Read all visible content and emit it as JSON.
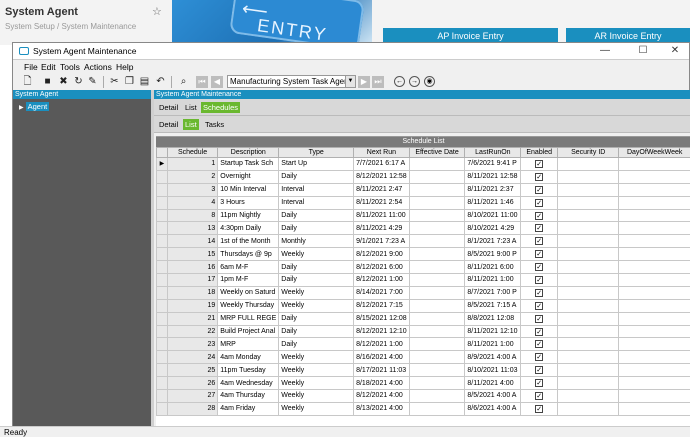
{
  "app": {
    "title": "System Agent",
    "breadcrumb": "System Setup / System Maintenance",
    "banner_text": "ENTRY",
    "tiles": [
      "AP Invoice Entry",
      "AR Invoice Entry"
    ]
  },
  "window": {
    "title": "System Agent Maintenance",
    "controls": {
      "minimize": "—",
      "maximize": "☐",
      "close": "✕"
    }
  },
  "menu": [
    "File",
    "Edit",
    "Tools",
    "Actions",
    "Help"
  ],
  "toolbar": {
    "combo_value": "Manufacturing System Task Agen"
  },
  "left_panel": {
    "header": "System Agent",
    "item": "Agent"
  },
  "right_panel": {
    "header": "System Agent Maintenance",
    "tabs_top": [
      "Detail",
      "List",
      "Schedules"
    ],
    "tabs_sub": [
      "Detail",
      "List",
      "Tasks"
    ]
  },
  "grid": {
    "title": "Schedule List",
    "columns": [
      "Schedule",
      "Description",
      "Type",
      "Next Run",
      "Effective Date",
      "LastRunOn",
      "Enabled",
      "Security ID",
      "DayOfWeekWeek"
    ],
    "rows": [
      {
        "schedule": "1",
        "description": "Startup Task Sch",
        "type": "Start Up",
        "next_run": "7/7/2021 6:17 A",
        "effective": "",
        "last_run": "7/6/2021 9:41 P",
        "enabled": true
      },
      {
        "schedule": "2",
        "description": "Overnight",
        "type": "Daily",
        "next_run": "8/12/2021 12:58",
        "effective": "",
        "last_run": "8/11/2021 12:58",
        "enabled": true
      },
      {
        "schedule": "3",
        "description": "10 Min Interval",
        "type": "Interval",
        "next_run": "8/11/2021 2:47",
        "effective": "",
        "last_run": "8/11/2021 2:37",
        "enabled": true
      },
      {
        "schedule": "4",
        "description": "3 Hours",
        "type": "Interval",
        "next_run": "8/11/2021 2:54",
        "effective": "",
        "last_run": "8/11/2021 1:46",
        "enabled": true
      },
      {
        "schedule": "8",
        "description": "11pm Nightly",
        "type": "Daily",
        "next_run": "8/11/2021 11:00",
        "effective": "",
        "last_run": "8/10/2021 11:00",
        "enabled": true
      },
      {
        "schedule": "13",
        "description": "4:30pm Daily",
        "type": "Daily",
        "next_run": "8/11/2021 4:29",
        "effective": "",
        "last_run": "8/10/2021 4:29",
        "enabled": true
      },
      {
        "schedule": "14",
        "description": "1st of the Month",
        "type": "Monthly",
        "next_run": "9/1/2021 7:23 A",
        "effective": "",
        "last_run": "8/1/2021 7:23 A",
        "enabled": true
      },
      {
        "schedule": "15",
        "description": "Thursdays @ 9p",
        "type": "Weekly",
        "next_run": "8/12/2021 9:00",
        "effective": "",
        "last_run": "8/5/2021 9:00 P",
        "enabled": true
      },
      {
        "schedule": "16",
        "description": "6am M-F",
        "type": "Daily",
        "next_run": "8/12/2021 6:00",
        "effective": "",
        "last_run": "8/11/2021 6:00",
        "enabled": true
      },
      {
        "schedule": "17",
        "description": "1pm M-F",
        "type": "Daily",
        "next_run": "8/12/2021 1:00",
        "effective": "",
        "last_run": "8/11/2021 1:00",
        "enabled": true
      },
      {
        "schedule": "18",
        "description": "Weekly on Saturd",
        "type": "Weekly",
        "next_run": "8/14/2021 7:00",
        "effective": "",
        "last_run": "8/7/2021 7:00 P",
        "enabled": true
      },
      {
        "schedule": "19",
        "description": "Weekly Thursday",
        "type": "Weekly",
        "next_run": "8/12/2021 7:15",
        "effective": "",
        "last_run": "8/5/2021 7:15 A",
        "enabled": true
      },
      {
        "schedule": "21",
        "description": "MRP FULL REGE",
        "type": "Daily",
        "next_run": "8/15/2021 12:08",
        "effective": "",
        "last_run": "8/8/2021 12:08",
        "enabled": true
      },
      {
        "schedule": "22",
        "description": "Build Project Anal",
        "type": "Daily",
        "next_run": "8/12/2021 12:10",
        "effective": "",
        "last_run": "8/11/2021 12:10",
        "enabled": true
      },
      {
        "schedule": "23",
        "description": "MRP",
        "type": "Daily",
        "next_run": "8/12/2021 1:00",
        "effective": "",
        "last_run": "8/11/2021 1:00",
        "enabled": true
      },
      {
        "schedule": "24",
        "description": "4am Monday",
        "type": "Weekly",
        "next_run": "8/16/2021 4:00",
        "effective": "",
        "last_run": "8/9/2021 4:00 A",
        "enabled": true
      },
      {
        "schedule": "25",
        "description": "11pm Tuesday",
        "type": "Weekly",
        "next_run": "8/17/2021 11:03",
        "effective": "",
        "last_run": "8/10/2021 11:03",
        "enabled": true
      },
      {
        "schedule": "26",
        "description": "4am Wednesday",
        "type": "Weekly",
        "next_run": "8/18/2021 4:00",
        "effective": "",
        "last_run": "8/11/2021 4:00",
        "enabled": true
      },
      {
        "schedule": "27",
        "description": "4am Thursday",
        "type": "Weekly",
        "next_run": "8/12/2021 4:00",
        "effective": "",
        "last_run": "8/5/2021 4:00 A",
        "enabled": true
      },
      {
        "schedule": "28",
        "description": "4am Friday",
        "type": "Weekly",
        "next_run": "8/13/2021 4:00",
        "effective": "",
        "last_run": "8/6/2021 4:00 A",
        "enabled": true
      }
    ]
  },
  "status": "Ready",
  "colors": {
    "accent": "#1a8fbf",
    "active_tab": "#6ab82f",
    "left_panel": "#595959"
  }
}
